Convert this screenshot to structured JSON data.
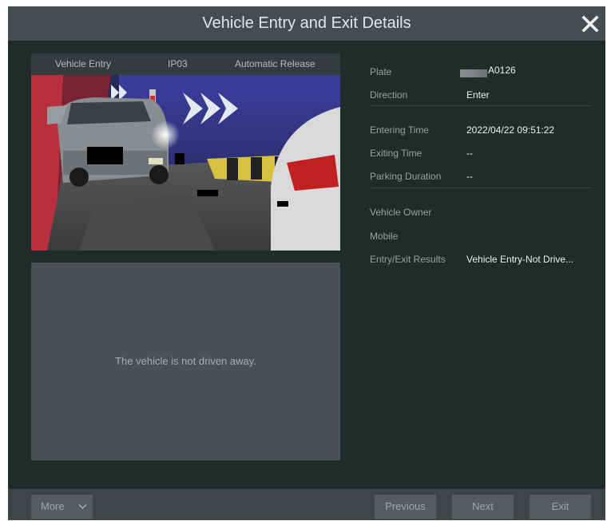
{
  "dialog": {
    "title": "Vehicle Entry and Exit Details",
    "close_icon": "close-icon"
  },
  "capture": {
    "event": "Vehicle Entry",
    "channel": "IP03",
    "release_mode": "Automatic Release",
    "photo_icon": "camera-snapshot"
  },
  "exit_panel": {
    "message": "The vehicle is not driven away."
  },
  "info": {
    "plate_label": "Plate",
    "plate_value": "A0126",
    "direction_label": "Direction",
    "direction_value": "Enter",
    "entering_time_label": "Entering Time",
    "entering_time_value": "2022/04/22 09:51:22",
    "exiting_time_label": "Exiting Time",
    "exiting_time_value": "--",
    "parking_duration_label": "Parking Duration",
    "parking_duration_value": "--",
    "vehicle_owner_label": "Vehicle Owner",
    "mobile_label": "Mobile",
    "results_label": "Entry/Exit Results",
    "results_value": "Vehicle Entry-Not Drive..."
  },
  "footer": {
    "more_label": "More",
    "previous_label": "Previous",
    "next_label": "Next",
    "exit_label": "Exit"
  },
  "colors": {
    "panel_bg": "#1f2c29",
    "titlebar_bg": "#484c4f",
    "button_bg": "#565b5e"
  }
}
